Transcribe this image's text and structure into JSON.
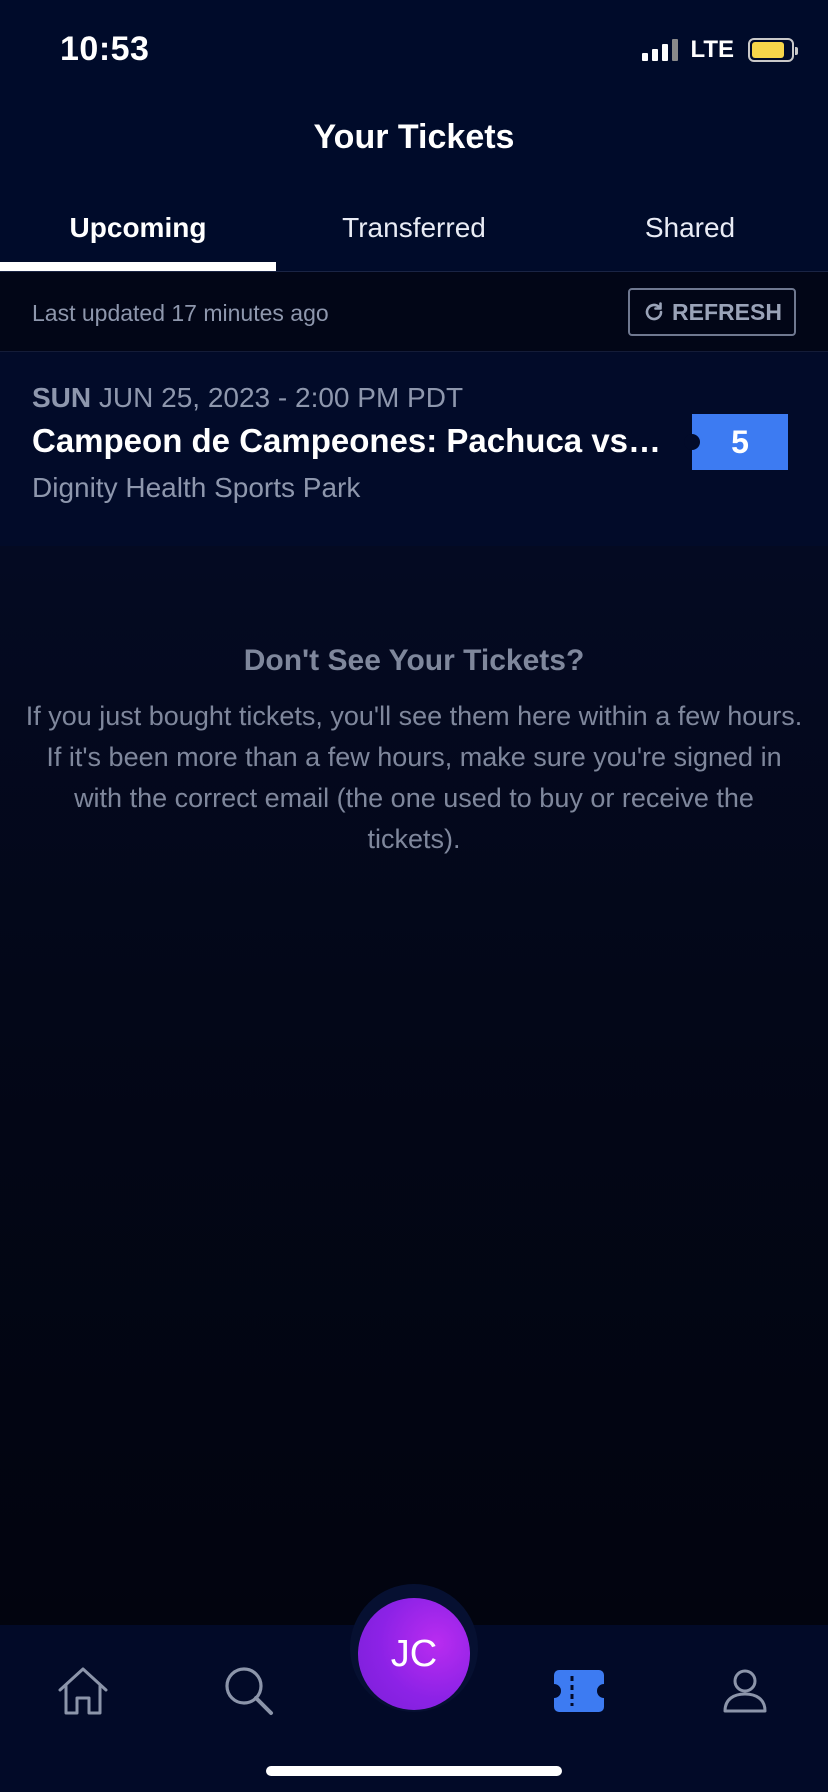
{
  "status_bar": {
    "time": "10:53",
    "network": "LTE",
    "battery_level": 0.85,
    "battery_color": "#f7d64a"
  },
  "header": {
    "title": "Your Tickets",
    "tabs": [
      {
        "label": "Upcoming",
        "active": true
      },
      {
        "label": "Transferred",
        "active": false
      },
      {
        "label": "Shared",
        "active": false
      }
    ]
  },
  "update_bar": {
    "last_updated": "Last updated 17 minutes ago",
    "refresh_label": "REFRESH"
  },
  "event": {
    "day": "SUN",
    "date": " JUN 25, 2023 - 2:00 PM PDT",
    "title": "Campeon de Campeones: Pachuca vs. Tigres",
    "venue": "Dignity Health Sports Park",
    "ticket_count": "5",
    "badge_color": "#3d7bf2"
  },
  "info": {
    "title": "Don't See Your Tickets?",
    "body": "If you just bought tickets, you'll see them here within a few hours. If it's been more than a few hours, make sure you're signed in with the correct email (the one used to buy or receive the tickets)."
  },
  "tab_bar": {
    "items": [
      {
        "icon": "home-icon"
      },
      {
        "icon": "search-icon"
      },
      {
        "avatar_initials": "JC"
      },
      {
        "icon": "ticket-icon",
        "active": true
      },
      {
        "icon": "account-icon"
      }
    ],
    "active_color": "#3d7bf2"
  }
}
